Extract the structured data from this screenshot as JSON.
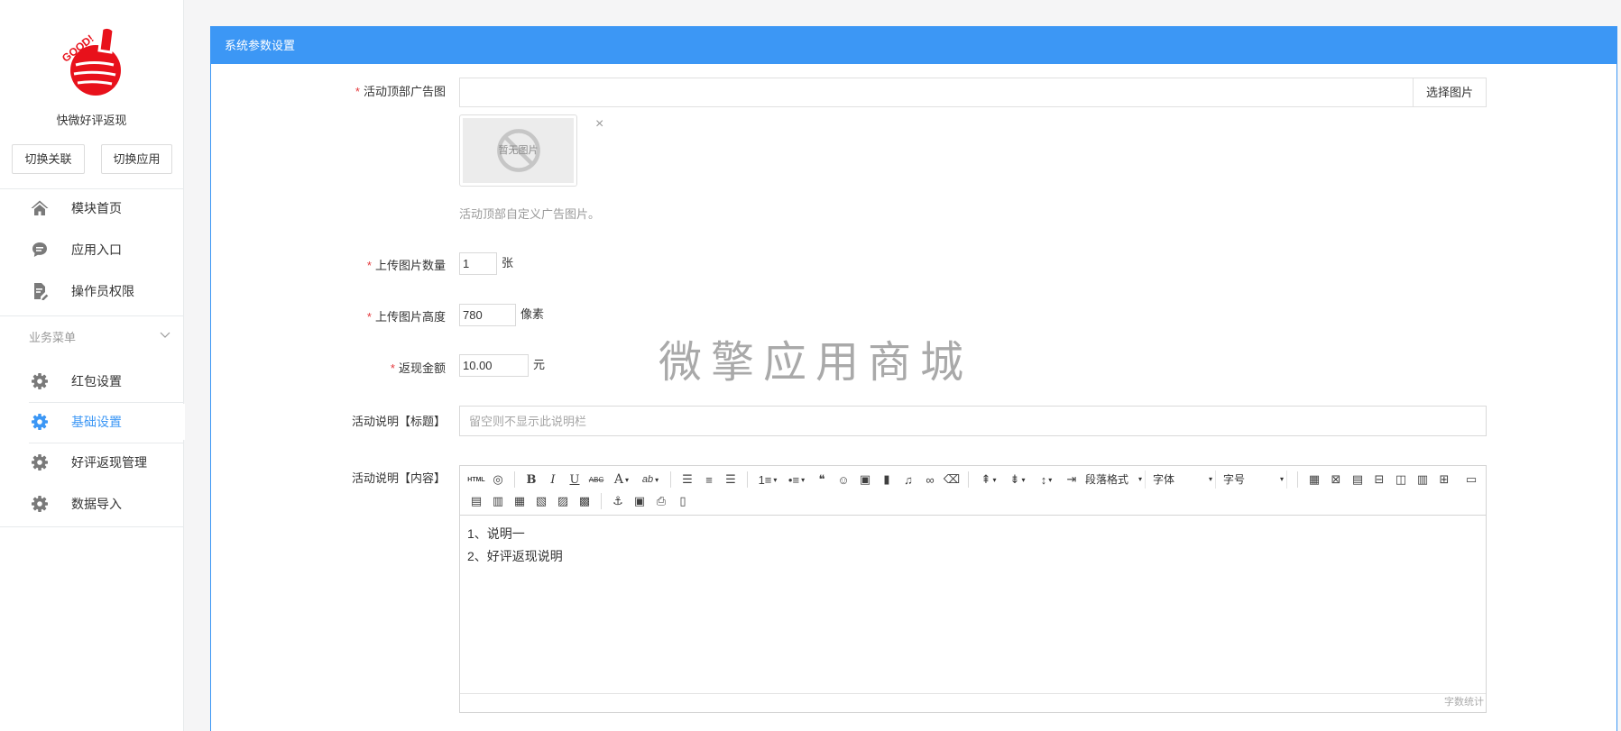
{
  "sidebar": {
    "logo_text": "GOOD!",
    "app_name": "快微好评返现",
    "switch_link_label": "切换关联",
    "switch_app_label": "切换应用",
    "menu": [
      {
        "label": "模块首页",
        "icon": "home-icon"
      },
      {
        "label": "应用入口",
        "icon": "comment-icon"
      },
      {
        "label": "操作员权限",
        "icon": "file-edit-icon"
      }
    ],
    "section_title": "业务菜单",
    "business_menu": [
      {
        "label": "红包设置",
        "icon": "gear-icon",
        "active": false
      },
      {
        "label": "基础设置",
        "icon": "gear-icon",
        "active": true
      },
      {
        "label": "好评返现管理",
        "icon": "gear-icon",
        "active": false
      },
      {
        "label": "数据导入",
        "icon": "gear-icon",
        "active": false
      }
    ]
  },
  "panel": {
    "title": "系统参数设置"
  },
  "form": {
    "required_mark": "*",
    "banner": {
      "label": "活动顶部广告图",
      "value": "",
      "button_label": "选择图片",
      "placeholder_image_text": "暂无图片",
      "help": "活动顶部自定义广告图片。"
    },
    "upload_count": {
      "label": "上传图片数量",
      "value": "1",
      "unit": "张"
    },
    "upload_height": {
      "label": "上传图片高度",
      "value": "780",
      "unit": "像素"
    },
    "cashback_amount": {
      "label": "返现金额",
      "value": "10.00",
      "unit": "元"
    },
    "desc_title": {
      "label": "活动说明【标题】",
      "value": "",
      "placeholder": "留空则不显示此说明栏"
    },
    "desc_content": {
      "label": "活动说明【内容】",
      "lines": [
        "1、说明一",
        "2、好评返现说明"
      ],
      "word_count_label": "字数统计"
    }
  },
  "editor": {
    "toolbar_row1": [
      [
        {
          "icon": "source-html-icon",
          "label": "HTML"
        },
        {
          "icon": "preview-icon"
        }
      ],
      [
        {
          "icon": "bold-icon",
          "label": "B"
        },
        {
          "icon": "italic-icon",
          "label": "I"
        },
        {
          "icon": "underline-icon",
          "label": "U"
        },
        {
          "icon": "strikethrough-icon",
          "label": "ABC"
        },
        {
          "icon": "font-color-icon",
          "label": "A",
          "dropdown": true
        },
        {
          "icon": "background-color-icon",
          "label": "ab",
          "dropdown": true
        }
      ],
      [
        {
          "icon": "align-left-icon"
        },
        {
          "icon": "align-center-icon"
        },
        {
          "icon": "align-right-icon"
        }
      ],
      [
        {
          "icon": "ordered-list-icon",
          "dropdown": true
        },
        {
          "icon": "unordered-list-icon",
          "dropdown": true
        },
        {
          "icon": "blockquote-icon"
        },
        {
          "icon": "emotion-icon"
        },
        {
          "icon": "insert-image-icon"
        },
        {
          "icon": "insert-video-icon"
        },
        {
          "icon": "music-icon"
        },
        {
          "icon": "link-icon"
        },
        {
          "icon": "clear-format-icon"
        }
      ],
      [
        {
          "icon": "row-spacing-top-icon",
          "dropdown": true
        },
        {
          "icon": "row-spacing-bottom-icon",
          "dropdown": true
        },
        {
          "icon": "line-height-icon",
          "dropdown": true
        },
        {
          "icon": "indent-icon"
        },
        {
          "name": "paragraph-select",
          "select": "段落格式"
        },
        {
          "name": "font-family-select",
          "select": "字体"
        },
        {
          "name": "font-size-select",
          "select": "字号"
        }
      ],
      [
        {
          "icon": "insert-table-icon"
        },
        {
          "icon": "delete-table-icon"
        },
        {
          "icon": "insert-caption-icon"
        },
        {
          "icon": "insert-row-icon"
        },
        {
          "icon": "insert-col-icon"
        },
        {
          "icon": "merge-cells-icon"
        },
        {
          "icon": "split-cells-icon"
        },
        {
          "icon": "fullscreen-icon"
        }
      ]
    ],
    "toolbar_row2": [
      [
        {
          "icon": "merge-right-icon"
        },
        {
          "icon": "merge-down-icon"
        },
        {
          "icon": "delete-row-icon"
        },
        {
          "icon": "delete-col-icon"
        },
        {
          "icon": "split-to-rows-icon"
        },
        {
          "icon": "split-to-cols-icon"
        }
      ],
      [
        {
          "icon": "anchor-icon"
        },
        {
          "icon": "insert-frame-icon"
        },
        {
          "icon": "print-icon"
        },
        {
          "icon": "template-icon"
        }
      ]
    ]
  },
  "watermark": "微擎应用商城",
  "colors": {
    "primary": "#3c97f5",
    "required_mark": "#e4393c",
    "logo_red": "#e8111b"
  }
}
